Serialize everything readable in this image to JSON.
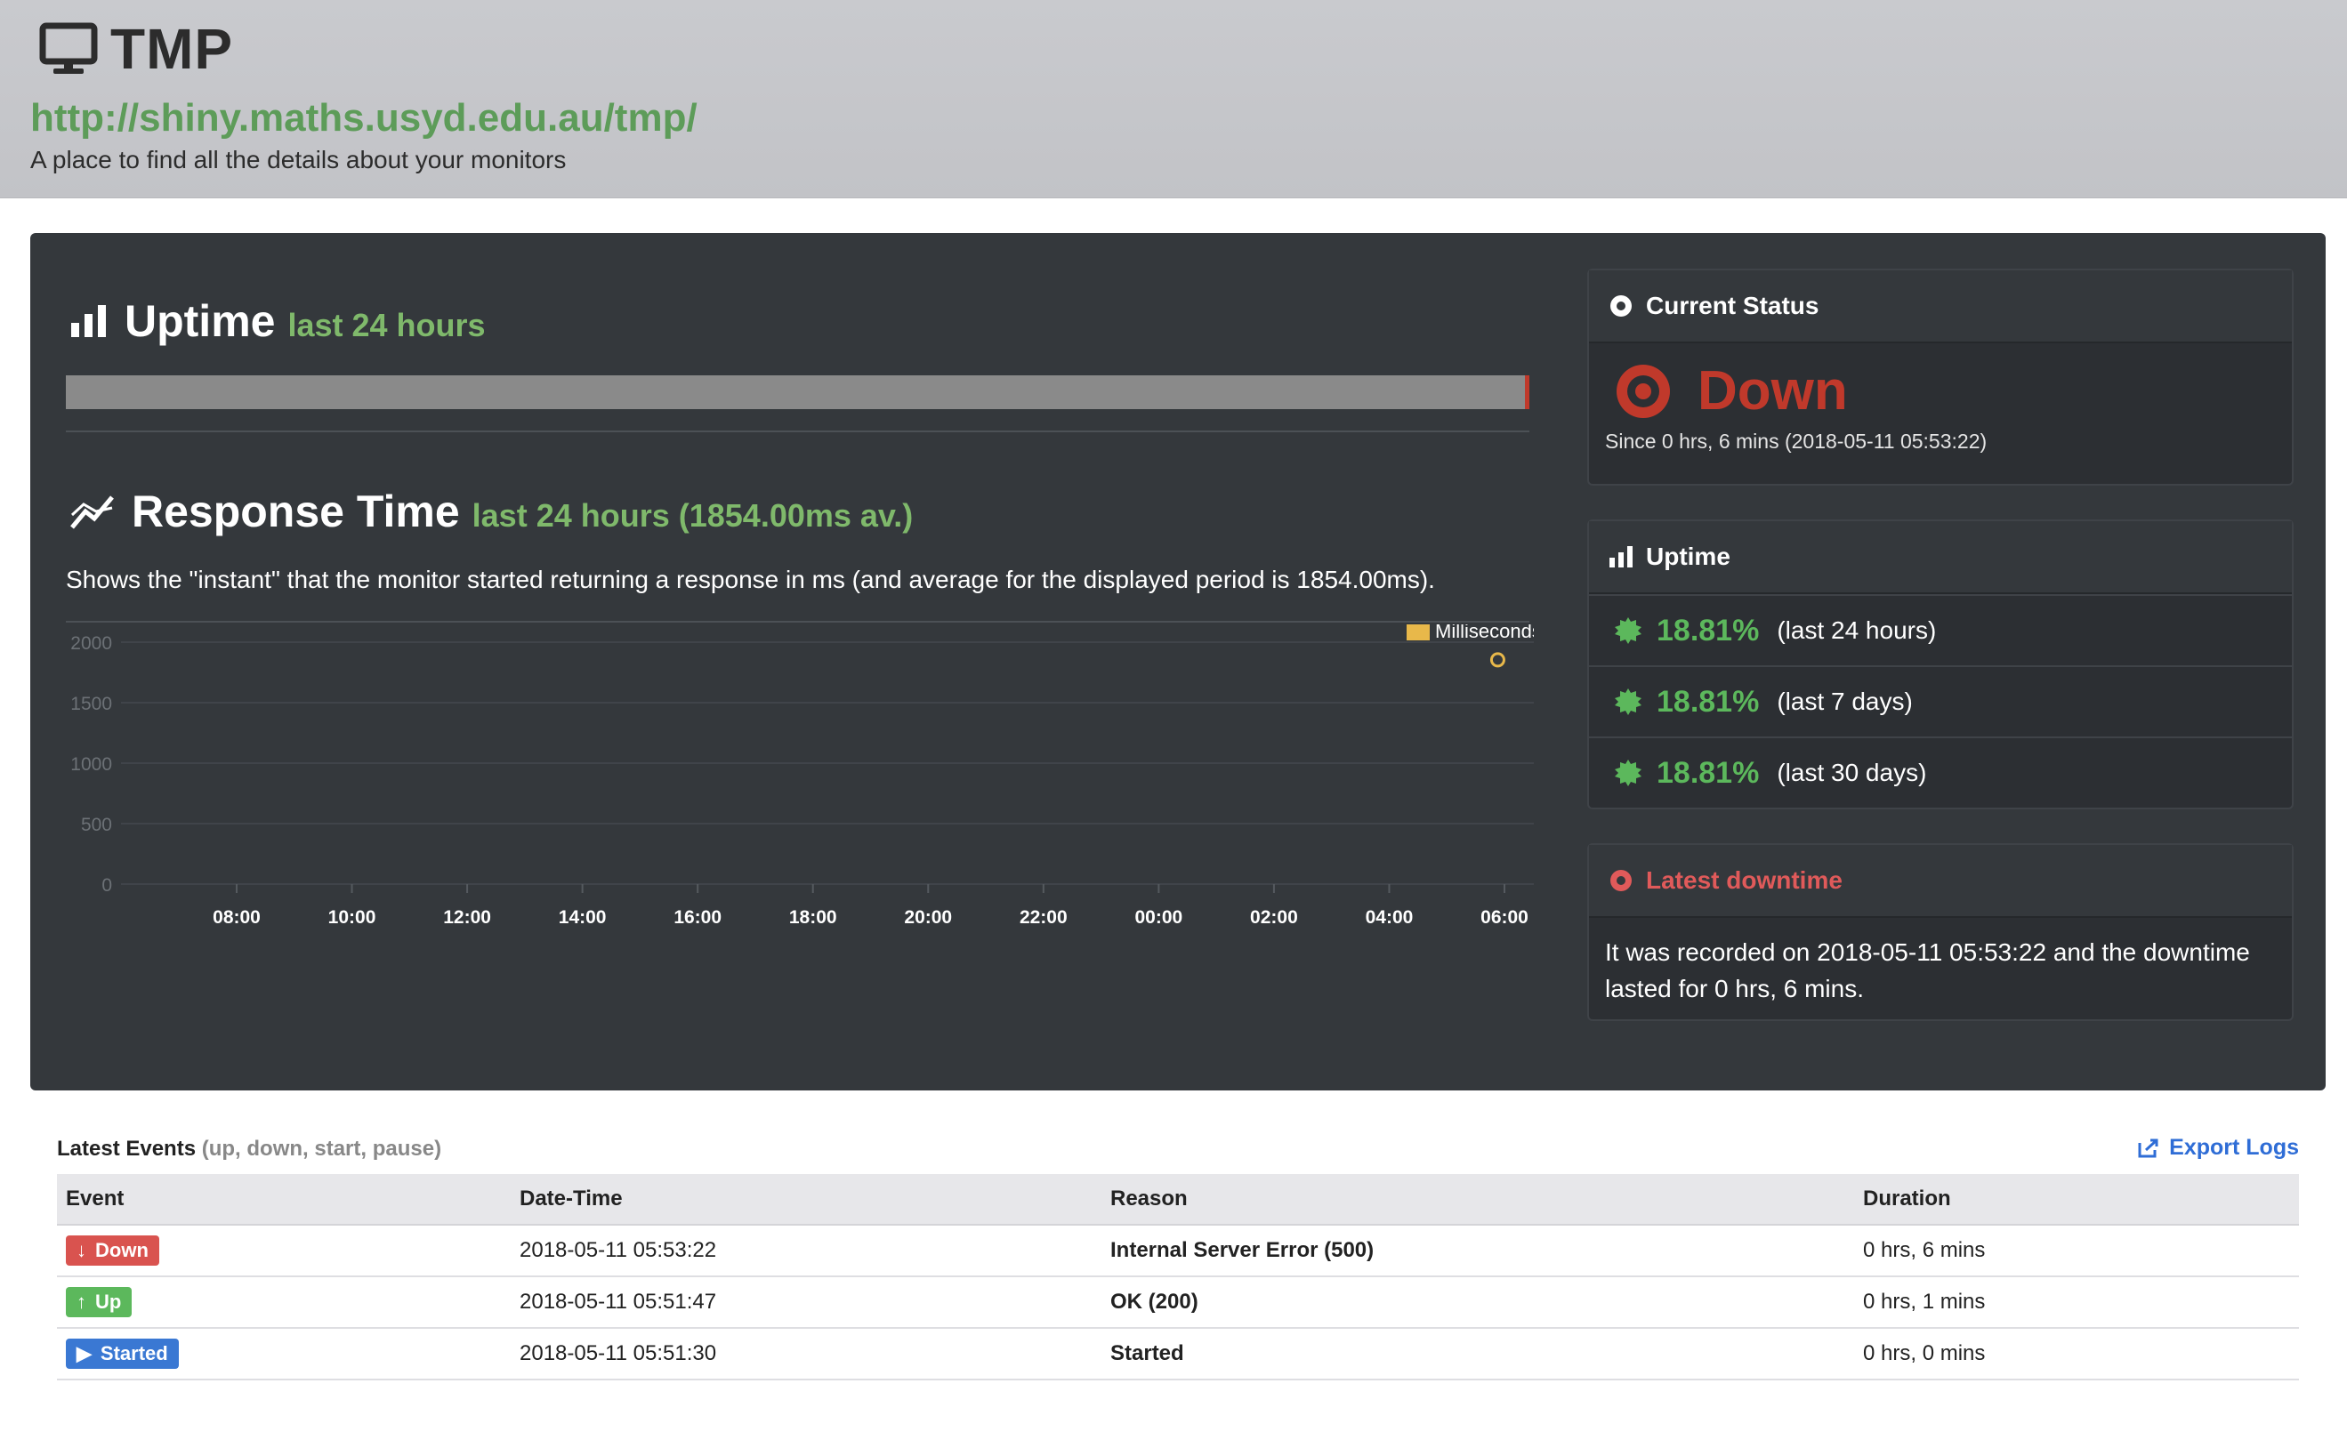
{
  "header": {
    "title": "TMP",
    "url": "http://shiny.maths.usyd.edu.au/tmp/",
    "tagline": "A place to find all the details about your monitors"
  },
  "uptime_section": {
    "title": "Uptime",
    "subtitle": "last 24 hours",
    "down_fraction": 0.003
  },
  "response_section": {
    "title": "Response Time",
    "subtitle": "last 24 hours (1854.00ms av.)",
    "description": "Shows the \"instant\" that the monitor started returning a response in ms (and average for the displayed period is 1854.00ms)."
  },
  "chart_data": {
    "type": "scatter",
    "legend": [
      "Milliseconds"
    ],
    "legend_position": "top-right",
    "yticks": [
      "2000",
      "1500",
      "1000",
      "500",
      "0"
    ],
    "xticks": [
      "08:00",
      "10:00",
      "12:00",
      "14:00",
      "16:00",
      "18:00",
      "20:00",
      "22:00",
      "00:00",
      "02:00",
      "04:00",
      "06:00"
    ],
    "ylim": [
      0,
      2000
    ],
    "series": [
      {
        "name": "Milliseconds",
        "points": [
          {
            "x": "05:53",
            "y": 1854
          }
        ]
      }
    ],
    "colors": {
      "series": "#e8b84a"
    }
  },
  "current_status": {
    "heading": "Current Status",
    "status": "Down",
    "since": "Since 0 hrs, 6 mins (2018-05-11 05:53:22)"
  },
  "uptime_card": {
    "heading": "Uptime",
    "rows": [
      {
        "pct": "18.81%",
        "range": "(last 24 hours)"
      },
      {
        "pct": "18.81%",
        "range": "(last 7 days)"
      },
      {
        "pct": "18.81%",
        "range": "(last 30 days)"
      }
    ]
  },
  "latest_downtime": {
    "heading": "Latest downtime",
    "text": "It was recorded on 2018-05-11 05:53:22 and the downtime lasted for 0 hrs, 6 mins."
  },
  "events": {
    "title": "Latest Events",
    "subtitle": "(up, down, start, pause)",
    "export_label": "Export Logs",
    "columns": [
      "Event",
      "Date-Time",
      "Reason",
      "Duration"
    ],
    "rows": [
      {
        "event": "Down",
        "datetime": "2018-05-11 05:53:22",
        "reason": "Internal Server Error (500)",
        "duration": "0 hrs, 6 mins"
      },
      {
        "event": "Up",
        "datetime": "2018-05-11 05:51:47",
        "reason": "OK (200)",
        "duration": "0 hrs, 1 mins"
      },
      {
        "event": "Started",
        "datetime": "2018-05-11 05:51:30",
        "reason": "Started",
        "duration": "0 hrs, 0 mins"
      }
    ]
  },
  "colors": {
    "accent_green": "#5cb85c",
    "down_red": "#c0392b",
    "panel_bg": "#34383c",
    "header_bg": "#c9cace",
    "link_blue": "#2f6dd6"
  }
}
